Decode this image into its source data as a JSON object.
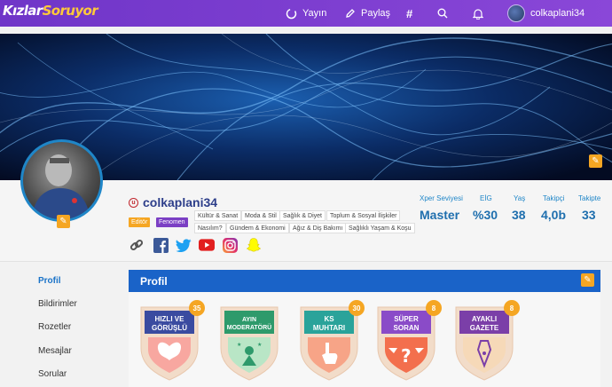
{
  "header": {
    "logo_part1": "Kızlar",
    "logo_part2": "Soruyor",
    "yayin_label": "Yayın",
    "paylas_label": "Paylaş",
    "hash_label": "#",
    "username": "colkaplani34"
  },
  "profile": {
    "username": "colkaplani34",
    "badges": [
      "Editör",
      "Fenomen"
    ],
    "tags": [
      "Kültür & Sanat",
      "Moda & Stil",
      "Sağlık & Diyet",
      "Toplum & Sosyal İlişkiler",
      "Nasılım?",
      "Gündem & Ekonomi",
      "Ağız & Diş Bakımı",
      "Sağlıklı Yaşam & Koşu"
    ],
    "socials": [
      "link-icon",
      "facebook-icon",
      "twitter-icon",
      "youtube-icon",
      "instagram-icon",
      "snapchat-icon"
    ]
  },
  "stats": {
    "xper_label": "Xper Seviyesi",
    "xper_value": "Master",
    "eig_label": "EİG",
    "eig_value": "%30",
    "yas_label": "Yaş",
    "yas_value": "38",
    "takipci_label": "Takipçi",
    "takipci_value": "4,0b",
    "takipte_label": "Takipte",
    "takipte_value": "33"
  },
  "sidebar": {
    "items": [
      {
        "label": "Profil",
        "active": true
      },
      {
        "label": "Bildirimler"
      },
      {
        "label": "Rozetler"
      },
      {
        "label": "Mesajlar"
      },
      {
        "label": "Sorular"
      }
    ]
  },
  "panel": {
    "title": "Profil",
    "rozetler": [
      {
        "name_line1": "HIZLI VE",
        "name_line2": "GÖRÜŞLÜ",
        "count": "35",
        "color": "#3a4ba0"
      },
      {
        "name_line1": "AYIN",
        "name_line2": "MODERATÖRÜ",
        "count": "",
        "color": "#2e9a6b"
      },
      {
        "name_line1": "KS",
        "name_line2": "MUHTARI",
        "count": "30",
        "color": "#2aa39a"
      },
      {
        "name_line1": "SÜPER",
        "name_line2": "SORAN",
        "count": "8",
        "color": "#8a4bc8"
      },
      {
        "name_line1": "AYAKLI",
        "name_line2": "GAZETE",
        "count": "8",
        "color": "#7b3fa8"
      }
    ]
  },
  "colors": {
    "topbar": "#7a3ccf",
    "accent_blue": "#1a63c8",
    "accent_orange": "#f5a623"
  }
}
